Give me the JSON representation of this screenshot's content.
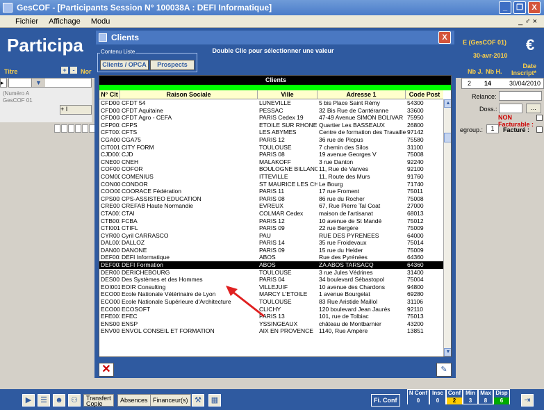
{
  "window": {
    "title": "GesCOF - [Participants Session N° 100038A : DEFI Informatique]",
    "minimize": "_",
    "restore": "❐",
    "close": "X"
  },
  "menu": {
    "items": [
      "Fichier",
      "Affichage",
      "Modu"
    ],
    "mdi_controls": "_ ♂ ×"
  },
  "header": {
    "title": "Participa",
    "app_tag": "E (GesCOF 01)",
    "date": "30-avr-2010",
    "euro": "€"
  },
  "columns": {
    "titre": "Titre",
    "nom": "Nor",
    "plus": "+",
    "minus": "-",
    "nbj": "Nb J.",
    "nbh": "Nb H.",
    "date_inscript": "Date\nInscript*"
  },
  "left_panel": {
    "gray_text1": "(Numéro A",
    "gray_text2": "GesCOF 01",
    "button": "+ I"
  },
  "right_panel": {
    "row_nbj": "2",
    "row_nbh": "14",
    "row_date": "30/04/2010",
    "relance_label": "Relance:",
    "doss_label": "Doss.:",
    "doss_btn": "...",
    "nonfact_label": "NON Facturable :",
    "regroup_label": "egroup.:",
    "regroup_value": "1",
    "facture_label": "Facturé :"
  },
  "dialog": {
    "title": "Clients",
    "close": "X",
    "hint": "Double Clic pour sélectionner une valeur",
    "group_label": "Contenu Liste",
    "seg_clients": "Clients / OPCA",
    "seg_prospects": "Prospects",
    "grid_caption": "Clients",
    "headers": {
      "code": "N° Clt",
      "raison": "Raison Sociale",
      "ville": "Ville",
      "adresse": "Adresse 1",
      "cp": "Code Post"
    },
    "rows": [
      [
        "CFD001",
        "CFDT 54",
        "LUNEVILLE",
        "5 bis Place Saint Rémy",
        "54300"
      ],
      [
        "CFD002",
        "CFDT Aquitaine",
        "PESSAC",
        "32 Bis Rue de Cantéranne",
        "33600"
      ],
      [
        "CFD003",
        "CFDT Agro - CEFA",
        "PARIS Cedex 19",
        "47-49 Avenue SIMON BOLIVAR",
        "75950"
      ],
      [
        "CFP001",
        "CFPS",
        "ETOILE SUR RHONE",
        "Quartier Les BASSEAUX",
        "26800"
      ],
      [
        "CFT001",
        "CFTS",
        "LES ABYMES",
        "Centre de formation des Travailleurs S",
        "97142"
      ],
      [
        "CGA001",
        "CGA75",
        "PARIS 12",
        "36 rue de Picpus",
        "75580"
      ],
      [
        "CIT001",
        "CITY FORM",
        "TOULOUSE",
        "7 chemin des Silos",
        "31100"
      ],
      [
        "CJD001",
        "CJD",
        "PARIS 08",
        "19 avenue Georges V",
        "75008"
      ],
      [
        "CNE001",
        "CNEH",
        "MALAKOFF",
        "3 rue Danton",
        "92240"
      ],
      [
        "COF001",
        "COFOR",
        "BOULOGNE BILLANCO",
        "11, Rue de Vanves",
        "92100"
      ],
      [
        "COM001",
        "COMENIUS",
        "ITTEVILLE",
        "11, Route des Murs",
        "91760"
      ],
      [
        "CON001",
        "CONDOR",
        "ST MAURICE LES CHA",
        "Le Bourg",
        "71740"
      ],
      [
        "COO001",
        "COORACE Fédération",
        "PARIS 11",
        "17 rue Froment",
        "75011"
      ],
      [
        "CPS001",
        "CPS-ASSISTEO EDUCATION",
        "PARIS 08",
        "86 rue du Rocher",
        "75008"
      ],
      [
        "CRE001",
        "CREFAB Haute Normandie",
        "EVREUX",
        "67, Rue Pierre Tal Coat",
        "27000"
      ],
      [
        "CTA001",
        "CTAI",
        "COLMAR Cedex",
        "maison de l'artisanat",
        "68013"
      ],
      [
        "CTB001",
        "FCBA",
        "PARIS 12",
        "10 avenue de St Mandé",
        "75012"
      ],
      [
        "CTI001",
        "CTIFL",
        "PARIS 09",
        "22 rue Bergère",
        "75009"
      ],
      [
        "CYR001",
        "Cyril CARRASCO",
        "PAU",
        "RUE DES PYRENEES",
        "64000"
      ],
      [
        "DAL001",
        "DALLOZ",
        "PARIS 14",
        "35 rue Froidevaux",
        "75014"
      ],
      [
        "DAN001",
        "DANONE",
        "PARIS 09",
        "15 rue du Helder",
        "75009"
      ],
      [
        "DEF001",
        "DEFI Informatique",
        "ABOS",
        "Rue des Pyrénées",
        "64360"
      ],
      [
        "DEF003",
        "DEFI Formation",
        "ABOS",
        "ZA ABOS TARSACQ",
        "64360"
      ],
      [
        "DER001",
        "DERICHEBOURG",
        "TOULOUSE",
        "3 rue Jules Védrines",
        "31400"
      ],
      [
        "DES001",
        "Des Systèmes et des Hommes",
        "PARIS 04",
        "34 boulevard Sébastopol",
        "75004"
      ],
      [
        "EOI001",
        "EOIR Consulting",
        "VILLEJUIF",
        "10 avenue des Chardons",
        "94800"
      ],
      [
        "ECO002",
        "Ecole Nationale Vétérinaire de Lyon",
        "MARCY L'ETOILE",
        "1 avenue Bourgelat",
        "69280"
      ],
      [
        "ECO003",
        "Ecole Nationale Supérieure d'Architecture",
        "TOULOUSE",
        "83 Rue Aristide Maillol",
        "31106"
      ],
      [
        "ECO004",
        "ECOSOFT",
        "CLICHY",
        "120 boulevard Jean Jaurès",
        "92110"
      ],
      [
        "EFE001",
        "EFEC",
        "PARIS 13",
        "101, rue de Tolbiac",
        "75013"
      ],
      [
        "ENS001",
        "ENSP",
        "YSSINGEAUX",
        "château de Montbarnier",
        "43200"
      ],
      [
        "ENV001",
        "ENVOL CONSEIL ET FORMATION",
        "AIX EN PROVENCE",
        "1140, Rue Ampère",
        "13851"
      ]
    ],
    "selected_row": 22,
    "footer_close": "✕",
    "footer_new": "✎"
  },
  "bottom": {
    "transfert": "Transfert\nCopie",
    "absences": "Absences",
    "financeurs": "Financeur(s)",
    "fi_conf": "Fi. Conf",
    "stats": [
      {
        "h": "N Conf",
        "v": "0"
      },
      {
        "h": "Insc",
        "v": "0"
      },
      {
        "h": "Conf",
        "v": "2"
      },
      {
        "h": "Min",
        "v": "3"
      },
      {
        "h": "Max",
        "v": "8"
      },
      {
        "h": "Disp",
        "v": "6"
      }
    ]
  }
}
